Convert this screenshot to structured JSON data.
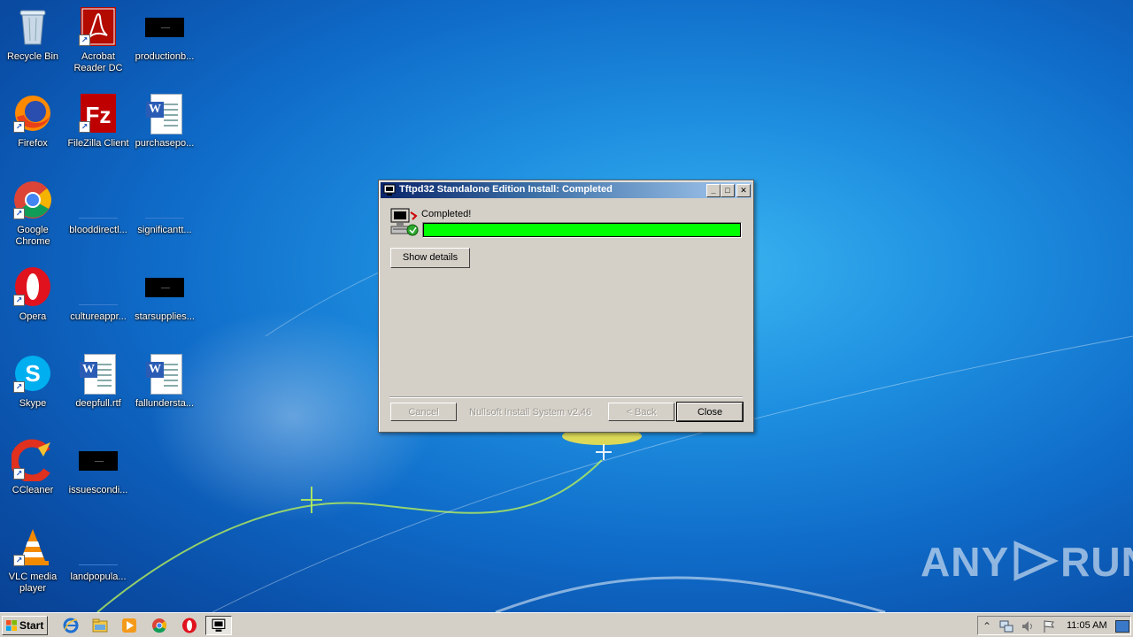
{
  "desktop": {
    "icons": [
      {
        "label": "Recycle Bin",
        "icon": "recycle-bin-icon"
      },
      {
        "label": "Acrobat Reader DC",
        "icon": "acrobat-reader-icon"
      },
      {
        "label": "productionb...",
        "icon": "black-document-icon"
      },
      {
        "label": "Firefox",
        "icon": "firefox-icon"
      },
      {
        "label": "FileZilla Client",
        "icon": "filezilla-icon"
      },
      {
        "label": "purchasepo...",
        "icon": "word-document-icon"
      },
      {
        "label": "Google Chrome",
        "icon": "chrome-icon"
      },
      {
        "label": "blooddirectl...",
        "icon": "blank-document-icon"
      },
      {
        "label": "significantt...",
        "icon": "blank-document-icon"
      },
      {
        "label": "Opera",
        "icon": "opera-icon"
      },
      {
        "label": "cultureappr...",
        "icon": "blank-document-icon"
      },
      {
        "label": "starsupplies...",
        "icon": "black-document-icon"
      },
      {
        "label": "Skype",
        "icon": "skype-icon"
      },
      {
        "label": "deepfull.rtf",
        "icon": "word-document-icon"
      },
      {
        "label": "fallundersta...",
        "icon": "word-document-icon"
      },
      {
        "label": "CCleaner",
        "icon": "ccleaner-icon"
      },
      {
        "label": "issuescondi...",
        "icon": "black-document-icon"
      },
      {
        "label": "VLC media player",
        "icon": "vlc-icon"
      },
      {
        "label": "landpopula...",
        "icon": "blank-document-icon"
      }
    ]
  },
  "dialog": {
    "title": "Tftpd32 Standalone Edition Install: Completed",
    "status": "Completed!",
    "progress_fraction": 1.0,
    "progress_color": "#00ff00",
    "show_details_label": "Show details",
    "cancel_label": "Cancel",
    "brand": "Nullsoft Install System v2.46",
    "back_label": "< Back",
    "close_label": "Close",
    "minimize_glyph": "_",
    "maximize_glyph": "□",
    "close_glyph": "✕"
  },
  "taskbar": {
    "start_label": "Start",
    "quick_launch": [
      "internet-explorer-icon",
      "file-explorer-icon",
      "media-player-icon",
      "chrome-icon",
      "opera-icon"
    ],
    "active_task_icon": "installer-icon",
    "tray_icons": [
      "show-hidden-icons",
      "network-icon",
      "volume-icon",
      "action-center-flag-icon"
    ],
    "clock": "11:05 AM"
  },
  "watermark": {
    "left": "ANY",
    "right": "RUN"
  }
}
